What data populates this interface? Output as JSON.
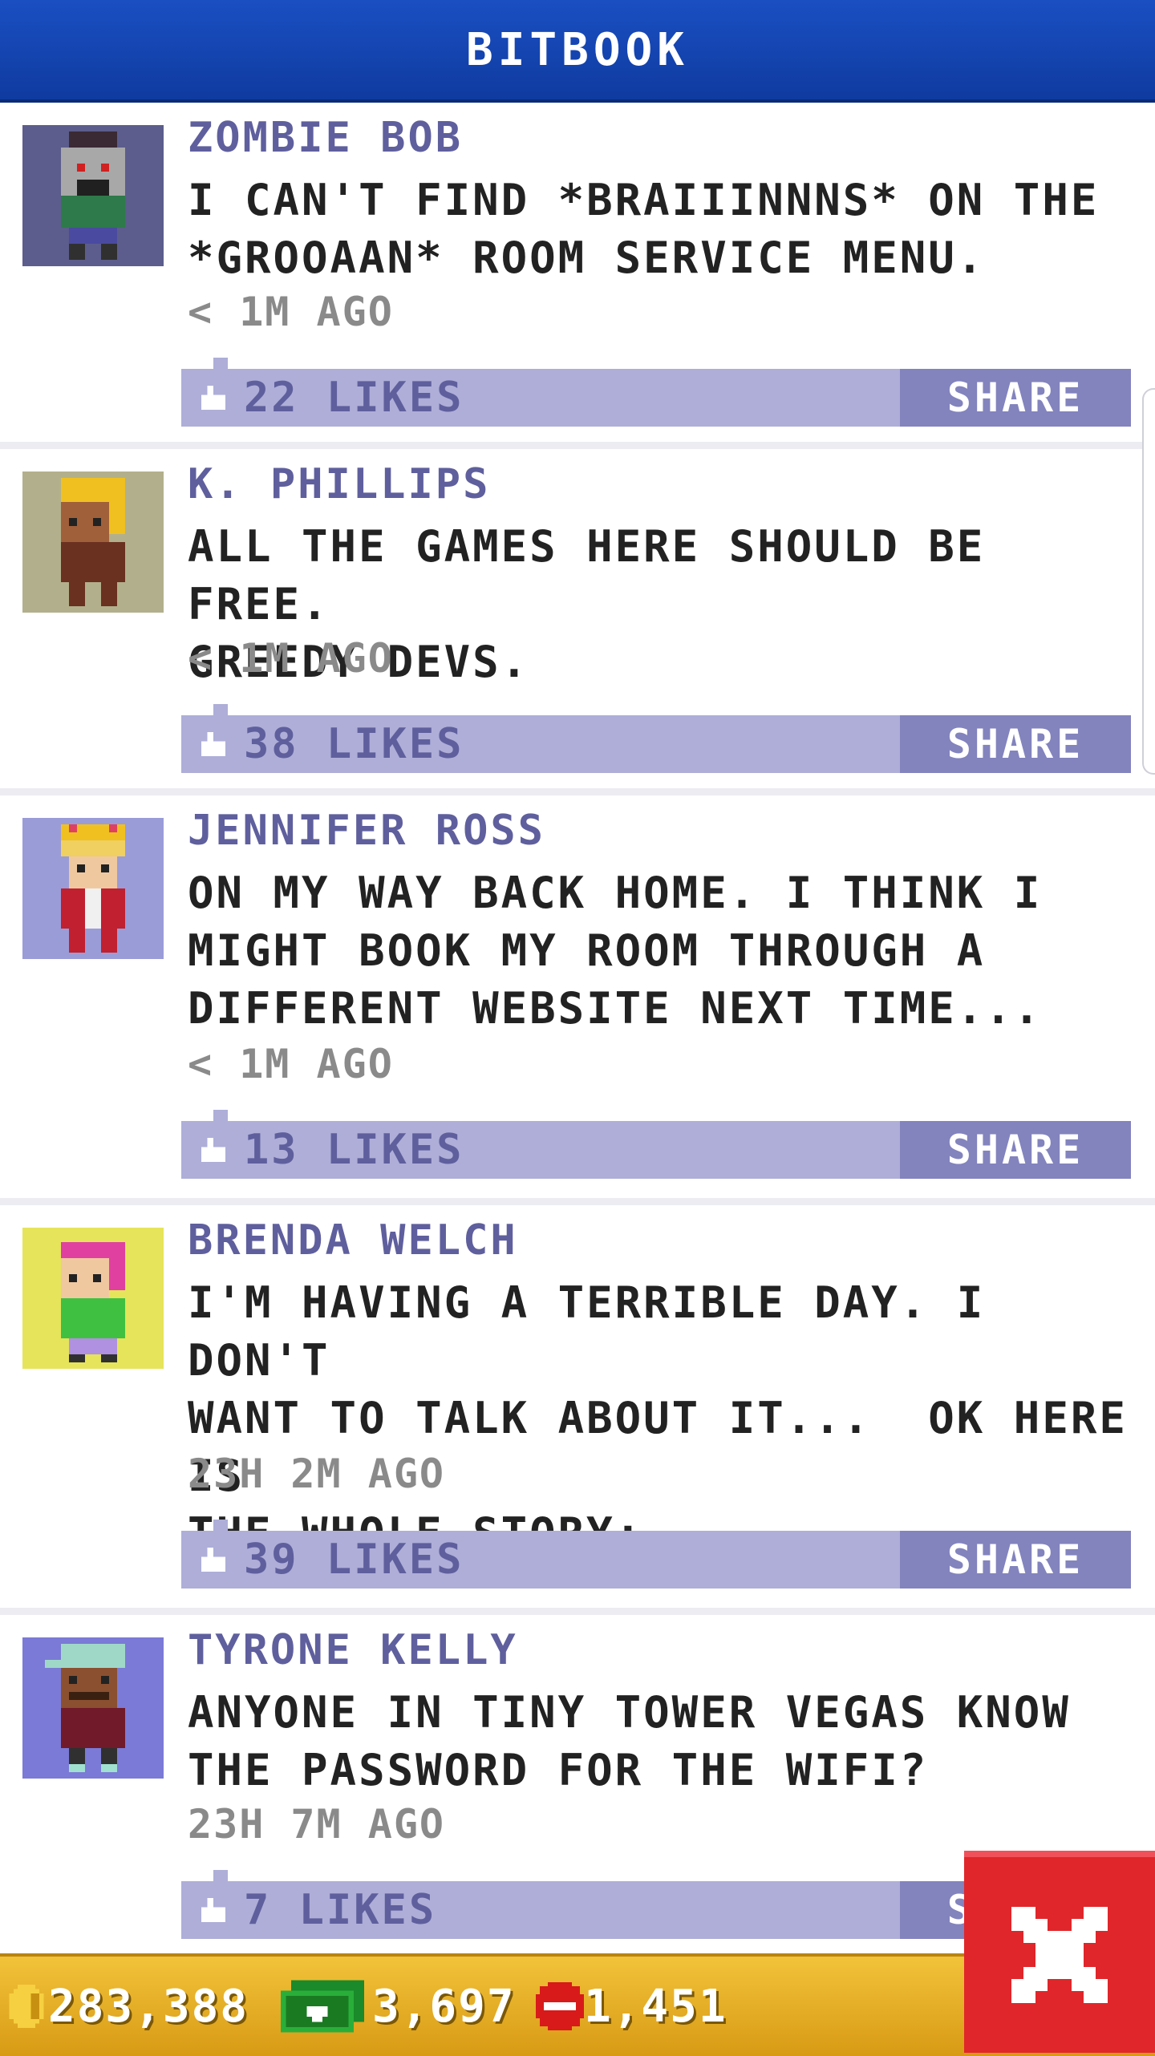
{
  "header": {
    "title": "BITBOOK"
  },
  "posts": [
    {
      "author": "ZOMBIE BOB",
      "text": "I CAN'T FIND *BRAIIINNNS* ON THE\n*GROOAAN* ROOM SERVICE MENU.",
      "time": "< 1M AGO",
      "likes": "22 LIKES",
      "share_label": "SHARE",
      "avatar_bg": "#5c5d8c"
    },
    {
      "author": "K. PHILLIPS",
      "text": "ALL THE GAMES HERE SHOULD BE FREE.\nGREEDY DEVS.",
      "time": "< 1M AGO",
      "likes": "38 LIKES",
      "share_label": "SHARE",
      "avatar_bg": "#b2b08c"
    },
    {
      "author": "JENNIFER ROSS",
      "text": "ON MY WAY BACK HOME. I THINK I\nMIGHT BOOK MY ROOM THROUGH A\nDIFFERENT WEBSITE NEXT TIME...",
      "time": "< 1M AGO",
      "likes": "13 LIKES",
      "share_label": "SHARE",
      "avatar_bg": "#9a9cd8"
    },
    {
      "author": "BRENDA WELCH",
      "text": "I'M HAVING A TERRIBLE DAY. I DON'T\nWANT TO TALK ABOUT IT...  OK HERE IS\nTHE WHOLE STORY:",
      "time": "23H 2M AGO",
      "likes": "39 LIKES",
      "share_label": "SHARE",
      "avatar_bg": "#e6e45a"
    },
    {
      "author": "TYRONE KELLY",
      "text": "ANYONE IN TINY TOWER VEGAS KNOW\nTHE PASSWORD FOR THE WIFI?",
      "time": "23H 7M AGO",
      "likes": "7 LIKES",
      "share_label": "SHARE",
      "avatar_bg": "#7b7ad6"
    }
  ],
  "footer": {
    "coins": "283,388",
    "bux": "3,697",
    "tickets": "1,451"
  },
  "colors": {
    "header": "#1a4fc2",
    "like_bar": "#aeaed8",
    "share_button": "#8383be",
    "author_text": "#5f5f9e",
    "footer": "#e6ac22",
    "close_button": "#e0262a"
  },
  "icons": {
    "like": "thumbs-up-icon",
    "coin": "coin-icon",
    "bux": "bux-banknote-icon",
    "ticket": "ticket-icon",
    "close": "close-icon"
  }
}
